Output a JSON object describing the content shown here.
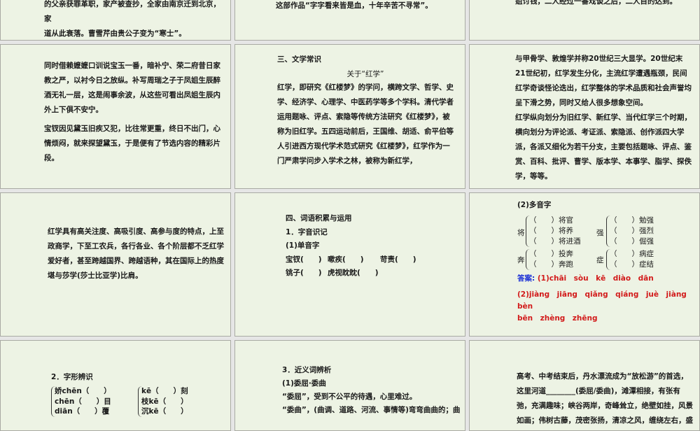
{
  "slides": {
    "r1c1": [
      "的父亲获罪革职，家产被查抄，全家由南京迁到北京，家",
      "道从此衰落。曹雪芹由贵公子变为“寒士”。"
    ],
    "r1c2": [
      "这部作品“字字看来皆是血，十年辛苦不寻常”。"
    ],
    "r1c3": [
      "姐讨钱，二人经过一番戏谈之后，二人目的达到。"
    ],
    "r2c1": [
      "同时借赖嬷嬷口训说宝玉一番，暗补宁、荣二府昔日家教之严，以衬今日之放纵。补写周瑞之子于凤姐生辰醉酒无礼一层，这是闹事余波，从这些可看出凤姐生辰内外上下俱不安宁。",
      "宝钗因见黛玉旧疾又犯，比往常更重，终日不出门，心情烦闷，就来探望黛玉，于是便有了节选内容的精彩片段。"
    ],
    "r2c2": {
      "heading": "三、文学常识",
      "title": "关于“红学”",
      "body": "红学，即研究《红楼梦》的学问，横跨文学、哲学、史学、经济学、心理学、中医药学等多个学科。清代学者运用题咏、评点、索隐等传统方法研究《红楼梦》，被称为旧红学。五四运动前后，王国维、胡适、俞平伯等人引进西方现代学术范式研究《红楼梦》，红学作为一门严肃学问步入学术之林，被称为新红学，"
    },
    "r2c3": [
      "与甲骨学、敦煌学并称20世纪三大显学。20世纪末21世纪初，红学发生分化，主流红学遭遇瓶颈，民间红学奇谈怪论迭出，红学整体的学术品质和社会声誉均呈下滑之势，同时又给人很多想象空间。",
      "红学纵向划分为旧红学、新红学、当代红学三个时期，横向划分为评论派、考证派、索隐派、创作派四大学派，各派又细化为若干分支，主要包括题咏、评点、鉴赏、百科、批评、曹学、版本学、本事学、脂学、探佚学，等等。"
    ],
    "r3c1": [
      "红学具有高关注度、高吸引度、高参与度的特点，上至政商学，下至工农兵，各行各业、各个阶层都不乏红学爱好者，甚至跨越国界、跨越语种，其在国际上的热度堪与莎学(莎士比亚学)比肩。"
    ],
    "r3c2": {
      "heading": "四、词语积累与运用",
      "sub1": "1．字音识记",
      "sub2": "(1)单音字",
      "items": [
        "宝钗(　　)",
        "嗽疾(　　)",
        "苛责(　　)",
        "铫子(　　)",
        "虎视眈眈(　　)"
      ]
    },
    "r3c3": {
      "title": "(2)多音字",
      "groups": [
        {
          "char": "将",
          "items": [
            "（　　）将官",
            "（　　）将养",
            "（　　）将进酒"
          ]
        },
        {
          "char": "强",
          "items": [
            "（　　）勉强",
            "（　　）强烈",
            "（　　）倔强"
          ]
        },
        {
          "char": "奔",
          "items": [
            "（　　）投奔",
            "（　　）奔跑"
          ]
        },
        {
          "char": "症",
          "items": [
            "（　　）病症",
            "（　　）症结"
          ]
        }
      ],
      "answer_label": "答案:",
      "answer1": "(1)chāi　sòu　kē　diào　dān",
      "answer2": "(2)jiàng　jiāng　qiǎng　qiáng　juè　jiàng　bèn",
      "answer3": "bēn　zhèng　zhēng"
    },
    "r4c1": {
      "heading": "2．字形辨识",
      "left": [
        "娇chēn（　　）",
        "chēn（　　）目",
        "diān（　　）覆"
      ],
      "right": [
        "kē（　　）刻",
        "枝kē（　　）",
        "沉kē（　　）"
      ]
    },
    "r4c2": {
      "heading": "3．近义词辨析",
      "sub": "(1)委屈·委曲",
      "l1": "“委屈”，受到不公平的待遇，心里难过。",
      "l2": "“委曲”，(曲调、道路、河流、事情等)弯弯曲曲的；曲"
    },
    "r4c3": [
      "高考、中考结束后，丹水漂流成为“放松游”的首选，这里河道________(委屈/委曲)，滩潭相接，有张有弛，充满趣味；峡谷两岸，奇峰耸立，绝壁如挂，风景如画；伟树古藤，茂密张扬，清凉之风，缠绕左右，盛夏之中，如临"
    ]
  }
}
